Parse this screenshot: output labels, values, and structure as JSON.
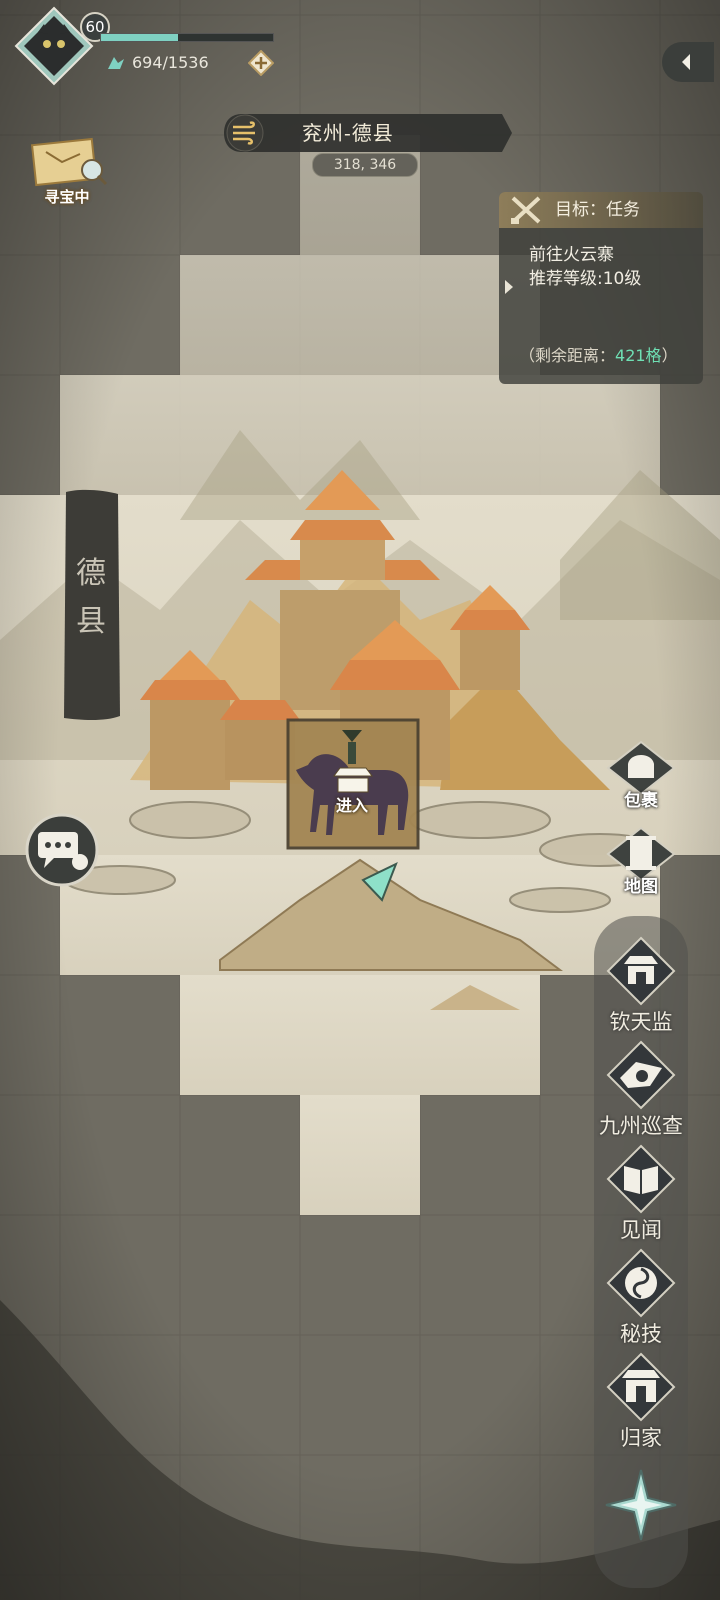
{
  "player": {
    "level": "60",
    "stamina_text": "694/1536",
    "stamina_fraction": 0.45,
    "avatar_icon": "black-cat-icon"
  },
  "location": {
    "name": "兖州-德县",
    "coords": "318, 346"
  },
  "treasure": {
    "label": "寻宝中",
    "icon": "treasure-map-icon"
  },
  "quest": {
    "title": "目标：任务",
    "line1": "前往火云寨",
    "line2": "推荐等级:10级",
    "distance_prefix": "（剩余距离：",
    "distance_value": "421格",
    "distance_suffix": "）",
    "distance_color": "#6fe0b4"
  },
  "map": {
    "city_label": "德县",
    "enter_label": "进入"
  },
  "side_menu": {
    "bag": "包裹",
    "map": "地图",
    "items": [
      {
        "label": "钦天监",
        "icon": "observatory-icon"
      },
      {
        "label": "九州巡查",
        "icon": "patrol-icon"
      },
      {
        "label": "见闻",
        "icon": "book-icon"
      },
      {
        "label": "秘技",
        "icon": "swirl-icon"
      },
      {
        "label": "归家",
        "icon": "home-gate-icon"
      }
    ]
  },
  "colors": {
    "accent": "#7fd1c2",
    "gold": "#d8b77a",
    "fog": "#6e6b61"
  }
}
